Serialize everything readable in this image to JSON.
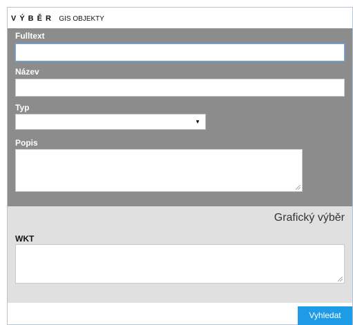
{
  "header": {
    "title_main": "VÝBĚR",
    "title_sub": "GIS OBJEKTY"
  },
  "form": {
    "fulltext": {
      "label": "Fulltext",
      "value": "",
      "placeholder": ""
    },
    "nazev": {
      "label": "Název",
      "value": "",
      "placeholder": ""
    },
    "typ": {
      "label": "Typ",
      "selected": ""
    },
    "popis": {
      "label": "Popis",
      "value": ""
    }
  },
  "graphic": {
    "title": "Grafický výběr",
    "wkt_label": "WKT",
    "wkt_value": ""
  },
  "actions": {
    "search_label": "Vyhledat"
  },
  "colors": {
    "form_background": "#8c8c8c",
    "graphic_background": "#e0e0e0",
    "button_background": "#1e9be6",
    "focus_border": "#6fa8dc"
  }
}
